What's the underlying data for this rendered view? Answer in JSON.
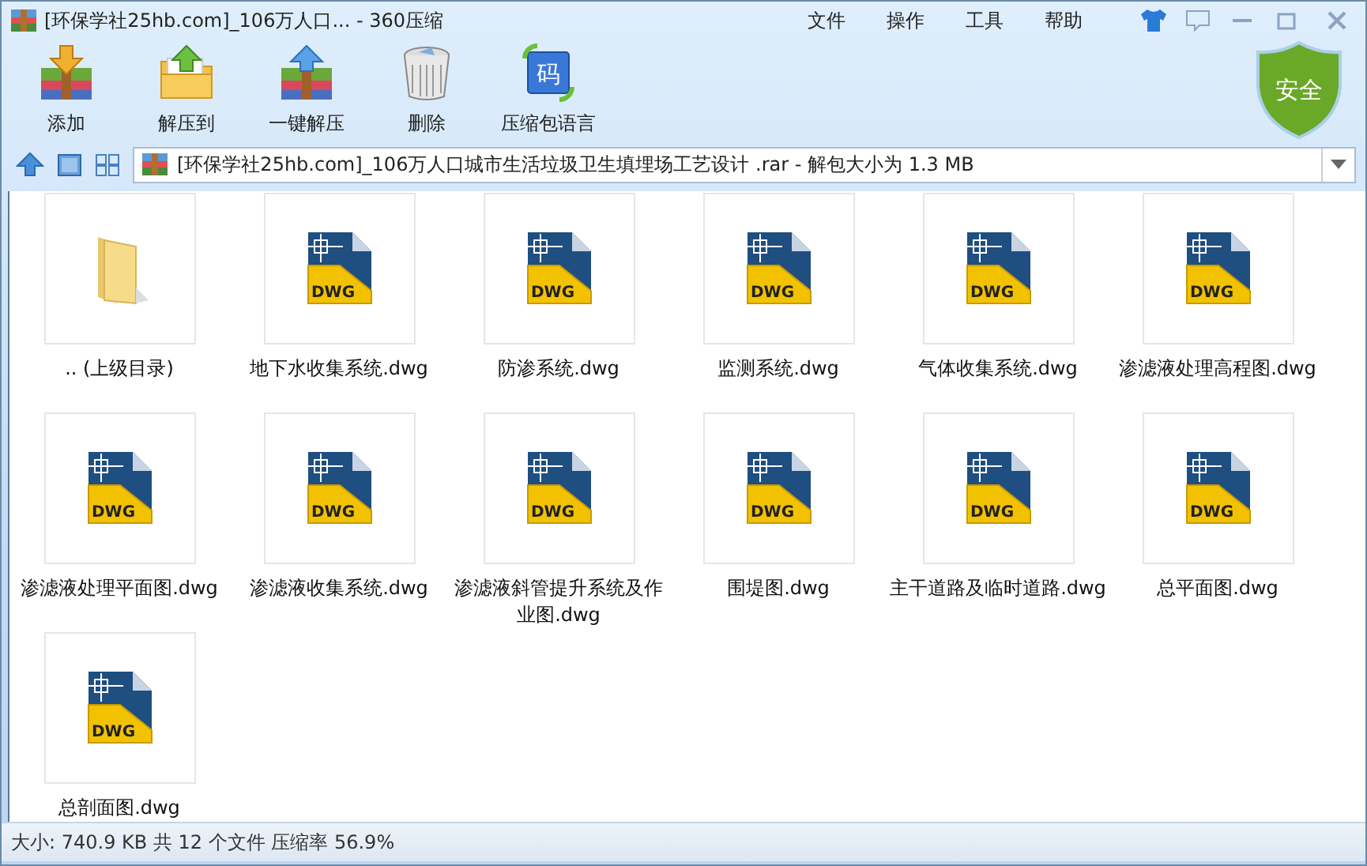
{
  "window": {
    "title": "[环保学社25hb.com]_106万人口... - 360压缩"
  },
  "menu": [
    "文件",
    "操作",
    "工具",
    "帮助"
  ],
  "toolbar": [
    {
      "label": "添加",
      "kind": "add"
    },
    {
      "label": "解压到",
      "kind": "extract"
    },
    {
      "label": "一键解压",
      "kind": "quick"
    },
    {
      "label": "删除",
      "kind": "delete"
    },
    {
      "label": "压缩包语言",
      "kind": "language",
      "icon_text": "码"
    }
  ],
  "security_badge": "安全",
  "address": {
    "value": "[环保学社25hb.com]_106万人口城市生活垃圾卫生填埋场工艺设计 .rar - 解包大小为 1.3 MB"
  },
  "files": [
    {
      "name": ".. (上级目录)",
      "kind": "folder"
    },
    {
      "name": "地下水收集系统.dwg",
      "kind": "dwg",
      "icon_text": "DWG"
    },
    {
      "name": "防渗系统.dwg",
      "kind": "dwg",
      "icon_text": "DWG"
    },
    {
      "name": "监测系统.dwg",
      "kind": "dwg",
      "icon_text": "DWG"
    },
    {
      "name": "气体收集系统.dwg",
      "kind": "dwg",
      "icon_text": "DWG"
    },
    {
      "name": "渗滤液处理高程图.dwg",
      "kind": "dwg",
      "icon_text": "DWG"
    },
    {
      "name": "渗滤液处理平面图.dwg",
      "kind": "dwg",
      "icon_text": "DWG"
    },
    {
      "name": "渗滤液收集系统.dwg",
      "kind": "dwg",
      "icon_text": "DWG"
    },
    {
      "name": "渗滤液斜管提升系统及作业图.dwg",
      "kind": "dwg",
      "icon_text": "DWG"
    },
    {
      "name": "围堤图.dwg",
      "kind": "dwg",
      "icon_text": "DWG"
    },
    {
      "name": "主干道路及临时道路.dwg",
      "kind": "dwg",
      "icon_text": "DWG"
    },
    {
      "name": "总平面图.dwg",
      "kind": "dwg",
      "icon_text": "DWG"
    },
    {
      "name": "总剖面图.dwg",
      "kind": "dwg",
      "icon_text": "DWG"
    }
  ],
  "status_bar": "大小: 740.9 KB 共 12 个文件 压缩率 56.9%"
}
